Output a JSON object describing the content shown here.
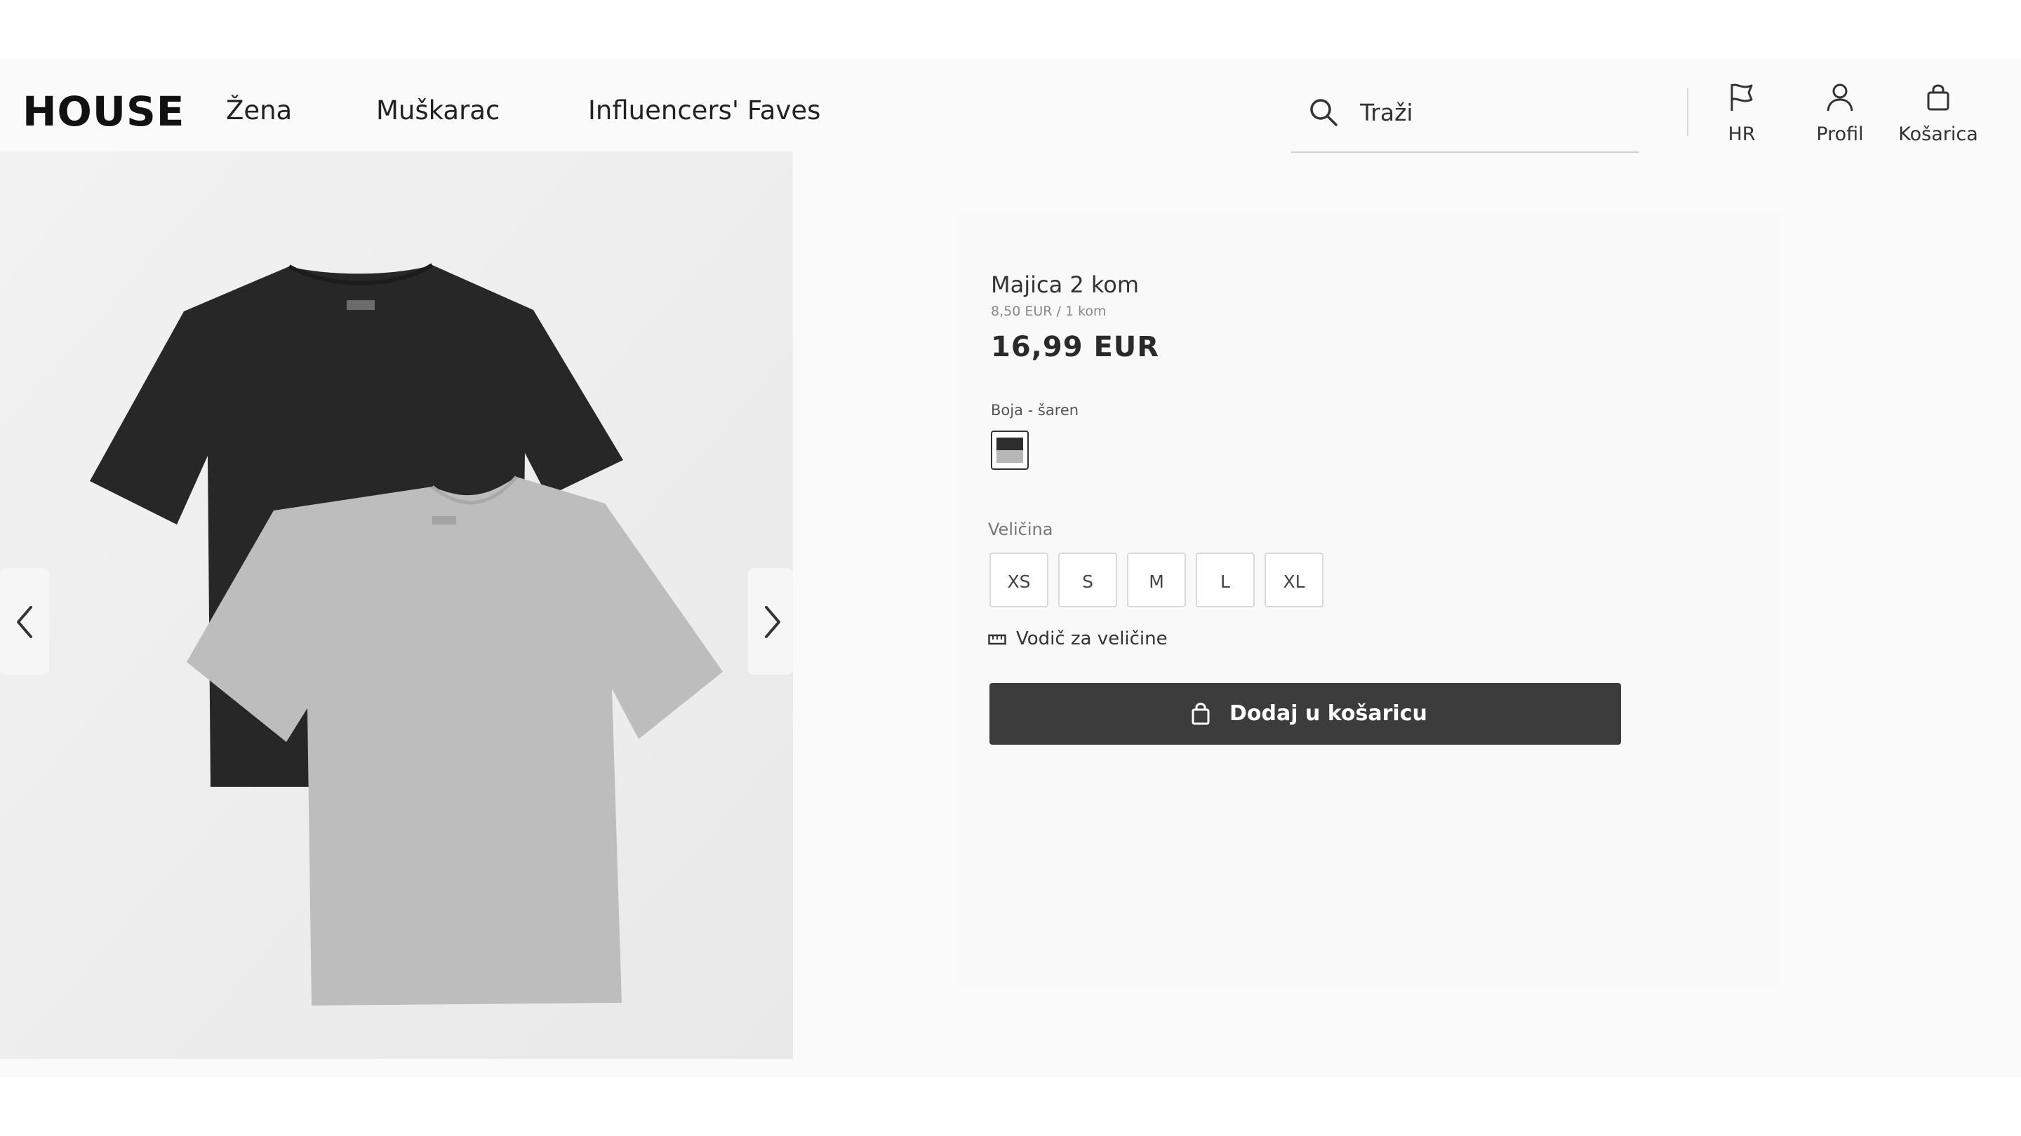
{
  "header": {
    "logo": "HOUSE",
    "nav": [
      "Žena",
      "Muškarac",
      "Influencers' Faves"
    ],
    "search_placeholder": "Traži",
    "icons": [
      {
        "label": "HR",
        "icon": "flag-icon"
      },
      {
        "label": "Profil",
        "icon": "user-icon"
      },
      {
        "label": "Košarica",
        "icon": "shopping-bag-icon"
      }
    ]
  },
  "gallery": {
    "prev_icon": "chevron-left-icon",
    "next_icon": "chevron-right-icon",
    "colors": {
      "dark_shirt": "#272727",
      "grey_shirt": "#bdbdbd"
    }
  },
  "product": {
    "title": "Majica 2 kom",
    "unit_price": "8,50 EUR / 1 kom",
    "price": "16,99 EUR",
    "color_label": "Boja - šaren",
    "size_label": "Veličina",
    "sizes": [
      "XS",
      "S",
      "M",
      "L",
      "XL"
    ],
    "size_guide": "Vodič za veličine",
    "add_to_cart": "Dodaj u košaricu",
    "button_color": "#3c3c3c"
  }
}
